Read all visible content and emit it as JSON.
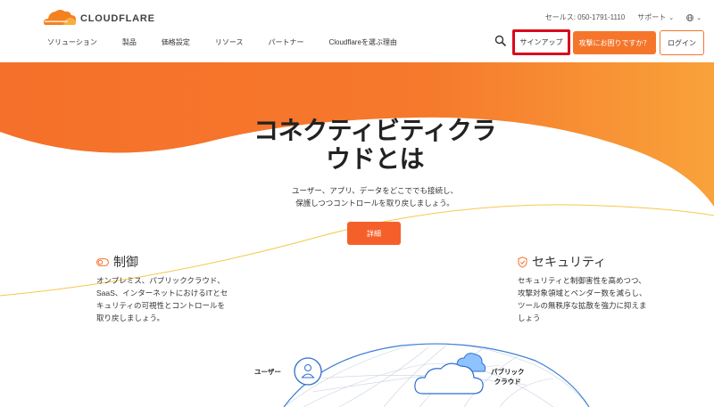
{
  "brand": {
    "name": "CLOUDFLARE",
    "orange": "#f48120",
    "orange_light": "#faad3f"
  },
  "top_util": {
    "sales": "セールス: 050-1791-1110",
    "support": "サポート",
    "language_icon": "globe-icon"
  },
  "nav": {
    "items": [
      "ソリューション",
      "製品",
      "価格設定",
      "リソース",
      "パートナー",
      "Cloudflareを選ぶ理由"
    ]
  },
  "header_buttons": {
    "signup": "サインアップ",
    "help": "攻撃にお困りですか？",
    "login": "ログイン"
  },
  "hero": {
    "title_line1": "コネクティビティクラ",
    "title_line2": "ウドとは",
    "subtitle_line1": "ユーザー、アプリ、データをどこででも接続し、",
    "subtitle_line2": "保護しつつコントロールを取り戻しましょう。",
    "cta": "詳細"
  },
  "features": {
    "control": {
      "title": "制御",
      "body_lines": [
        "オンプレミス、パブリッククラウド、",
        "SaaS、インターネットにおけるITとセ",
        "キュリティの可視性とコントロールを",
        "取り戻しましょう。"
      ]
    },
    "security": {
      "title": "セキュリティ",
      "body_lines": [
        "セキュリティと制御害性を高めつつ、",
        "攻撃対象領域とベンダー数を減らし、",
        "ツールの無秩序な拡散を強力に抑えま",
        "しょう"
      ]
    }
  },
  "diagram": {
    "user_label": "ユーザー",
    "cloud_label_line1": "パブリック",
    "cloud_label_line2": "クラウド"
  }
}
